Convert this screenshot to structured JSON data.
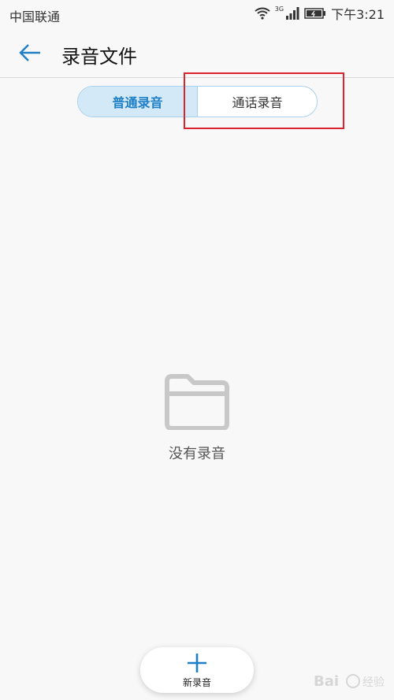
{
  "status_bar": {
    "carrier": "中国联通",
    "network": "3G",
    "time": "下午3:21"
  },
  "header": {
    "title": "录音文件"
  },
  "tabs": [
    {
      "label": "普通录音",
      "active": true
    },
    {
      "label": "通话录音",
      "active": false
    }
  ],
  "empty_state": {
    "text": "没有录音",
    "icon": "folder-icon"
  },
  "fab": {
    "label": "新录音",
    "icon": "plus-icon"
  },
  "colors": {
    "accent": "#1f7fc6",
    "highlight": "#d9232d",
    "active_tab_bg": "#d3e9f8"
  },
  "watermark": {
    "text": "Baidu 经验"
  }
}
